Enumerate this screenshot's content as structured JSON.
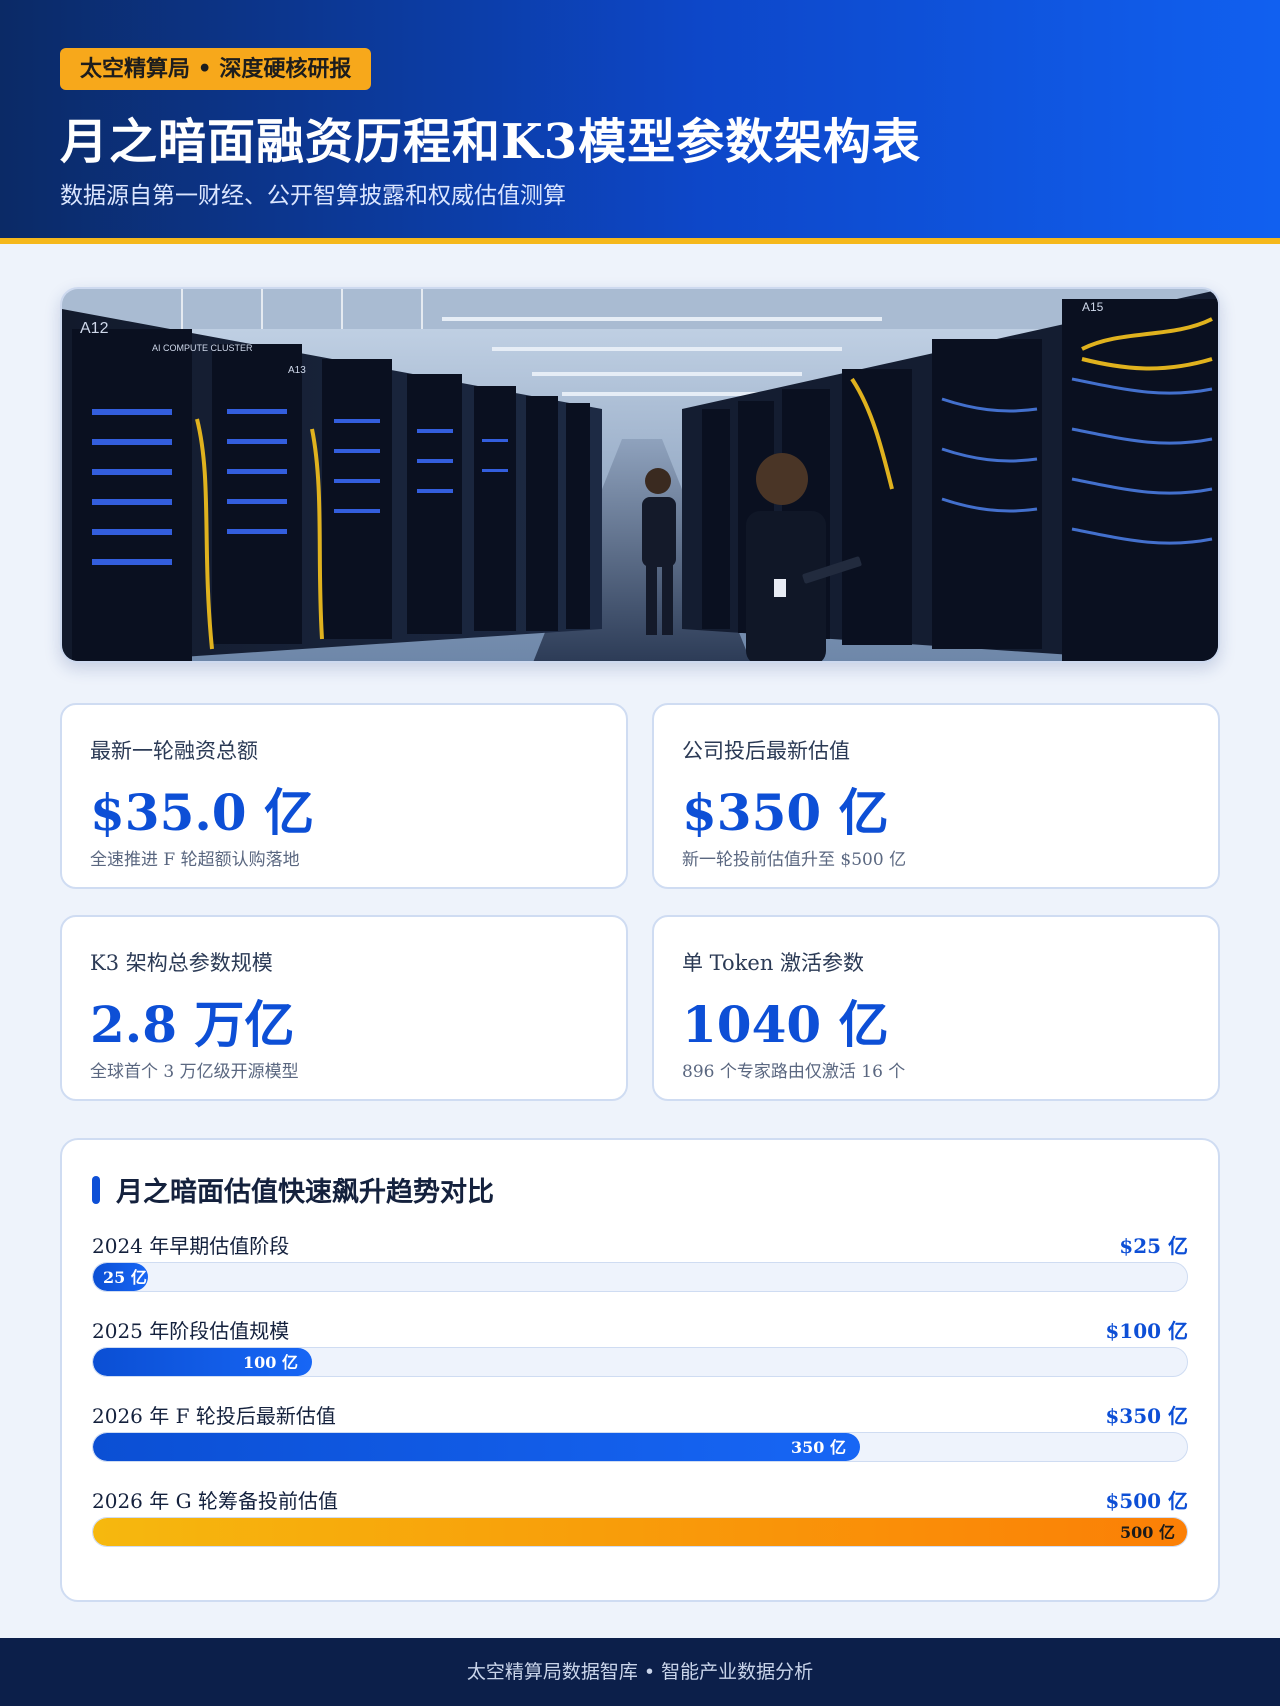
{
  "header": {
    "tag": "太空精算局 • 深度硬核研报",
    "title": "月之暗面融资历程和K3模型参数架构表",
    "subtitle": "数据源自第一财经、公开智算披露和权威估值测算"
  },
  "hero_image": {
    "rack_labels": [
      "A12",
      "AI COMPUTE CLUSTER",
      "A13",
      "A15"
    ]
  },
  "stats": [
    {
      "label": "最新一轮融资总额",
      "value": "$35.0 亿",
      "note": "全速推进 F 轮超额认购落地"
    },
    {
      "label": "公司投后最新估值",
      "value": "$350 亿",
      "note": "新一轮投前估值升至 $500 亿"
    },
    {
      "label": "K3 架构总参数规模",
      "value": "2.8 万亿",
      "note": "全球首个 3 万亿级开源模型"
    },
    {
      "label": "单 Token 激活参数",
      "value": "1040 亿",
      "note": "896 个专家路由仅激活 16 个"
    }
  ],
  "chart_data": {
    "type": "bar",
    "title": "月之暗面估值快速飙升趋势对比",
    "categories": [
      "2024 年早期估值阶段",
      "2025 年阶段估值规模",
      "2026 年 F 轮投后最新估值",
      "2026 年 G 轮筹备投前估值"
    ],
    "values": [
      25,
      100,
      350,
      500
    ],
    "value_labels": [
      "$25 亿",
      "$100 亿",
      "$350 亿",
      "$500 亿"
    ],
    "bar_labels": [
      "25 亿",
      "100 亿",
      "350 亿",
      "500 亿"
    ],
    "xlim": [
      0,
      500
    ],
    "colors": {
      "primary": "#0d4fd6",
      "highlight": "#fb8c05"
    }
  },
  "footer": {
    "text": "太空精算局数据智库 • 智能产业数据分析"
  }
}
